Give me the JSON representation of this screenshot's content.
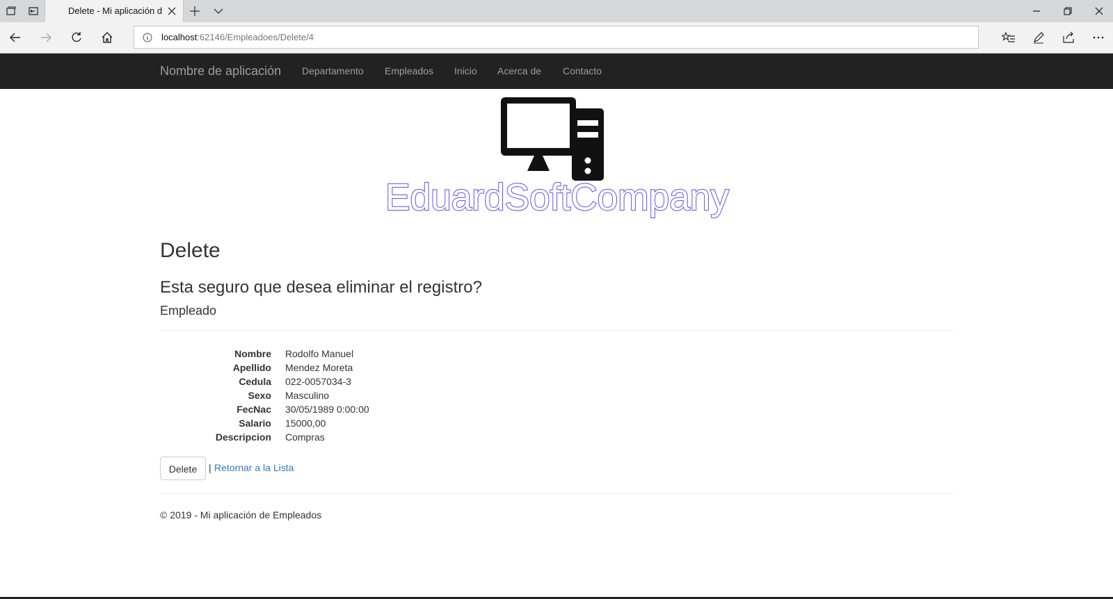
{
  "browser": {
    "tab_title": "Delete - Mi aplicación d",
    "url_host": "localhost",
    "url_path": ":62146/Empleadoes/Delete/4"
  },
  "navbar": {
    "brand": "Nombre de aplicación",
    "links": [
      "Departamento",
      "Empleados",
      "Inicio",
      "Acerca de",
      "Contacto"
    ]
  },
  "logo": {
    "text": "EduardSoftCompany",
    "text_color": "#6a5cf0"
  },
  "content": {
    "title": "Delete",
    "question": "Esta seguro que desea eliminar el registro?",
    "entity": "Empleado",
    "fields": [
      {
        "label": "Nombre",
        "value": "Rodolfo Manuel"
      },
      {
        "label": "Apellido",
        "value": "Mendez Moreta"
      },
      {
        "label": "Cedula",
        "value": "022-0057034-3"
      },
      {
        "label": "Sexo",
        "value": "Masculino"
      },
      {
        "label": "FecNac",
        "value": "30/05/1989 0:00:00"
      },
      {
        "label": "Salario",
        "value": "15000,00"
      },
      {
        "label": "Descripcion",
        "value": "Compras"
      }
    ],
    "delete_button": "Delete",
    "separator": "|",
    "back_link": "Retornar a la Lista"
  },
  "footer": {
    "text": "© 2019 - Mi aplicación de Empleados"
  },
  "colors": {
    "navbar_bg": "#222222",
    "nav_link": "#9d9d9d",
    "link": "#337ab7"
  }
}
